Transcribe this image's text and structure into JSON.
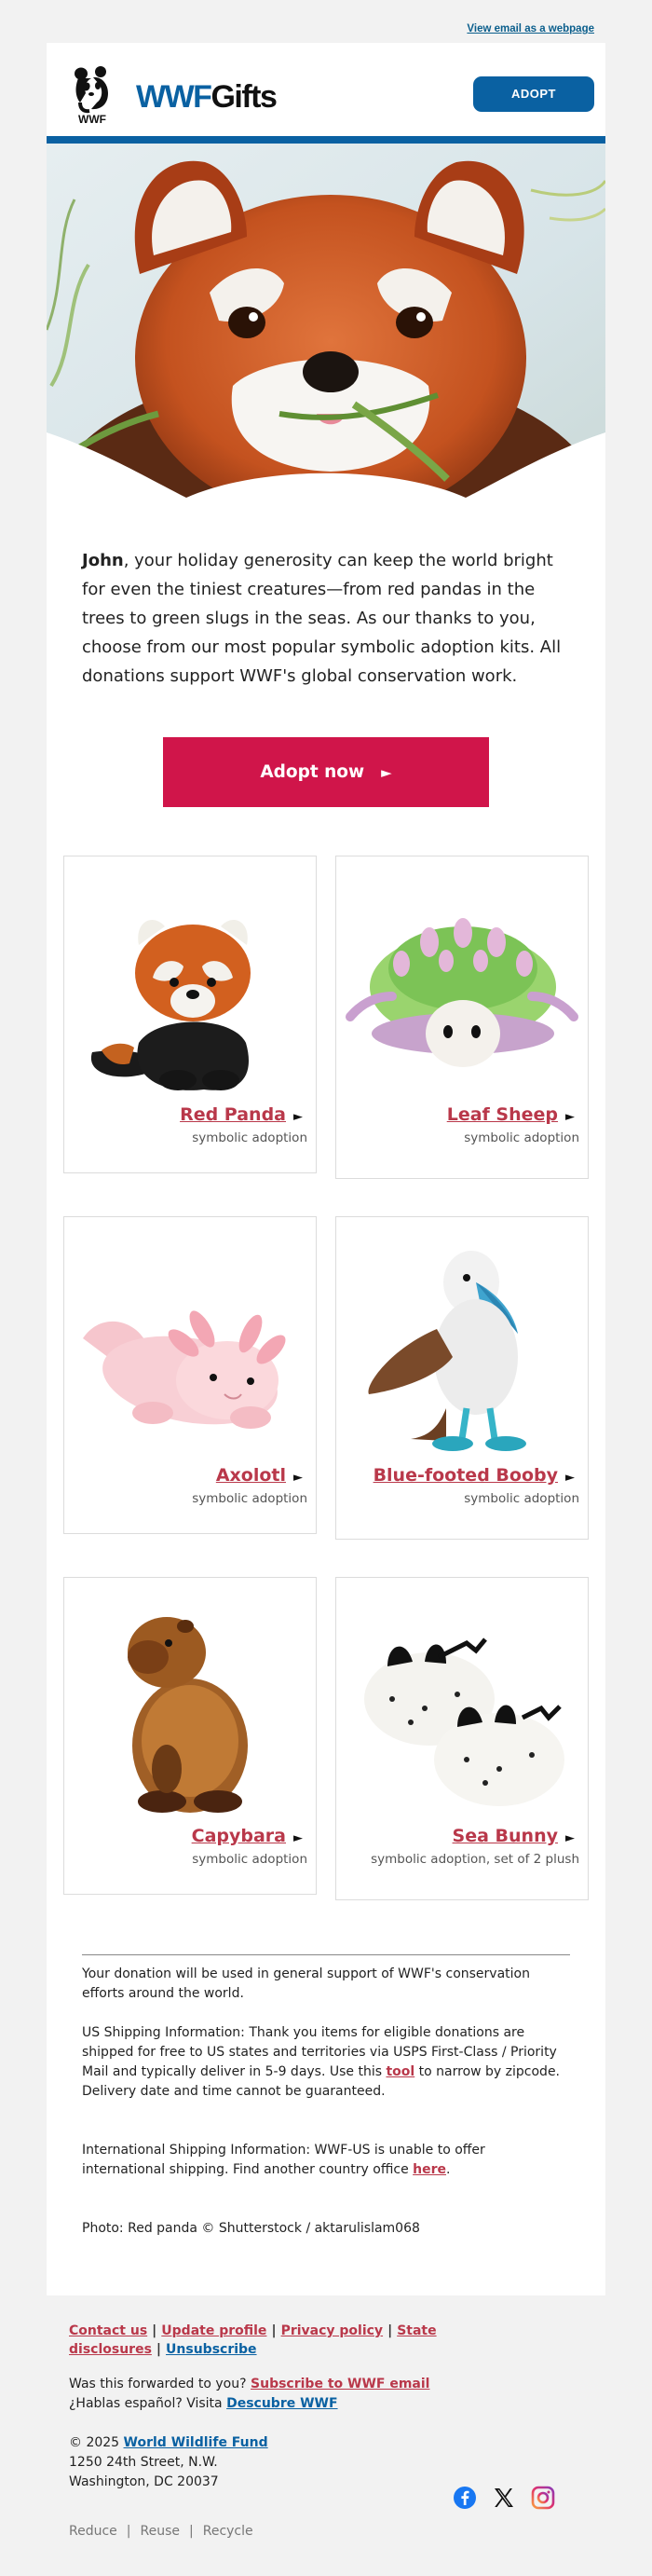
{
  "topbar": {
    "view_link": "View email as a webpage"
  },
  "header": {
    "logo_text": "WWF",
    "wordmark_brand": "WWF",
    "wordmark_suffix": "Gifts",
    "adopt_label": "ADOPT"
  },
  "intro": {
    "name": "John",
    "text": ", your holiday generosity can keep the world bright for even the tiniest creatures—from red pandas in the trees to green slugs in the seas. As our thanks to you, choose from our most popular symbolic adoption kits. All donations support WWF's global conservation work."
  },
  "cta": {
    "label": "Adopt now",
    "arrow": "►"
  },
  "products": [
    {
      "name": "Red Panda",
      "sub": "symbolic adoption",
      "icon": "red-panda-plush"
    },
    {
      "name": "Leaf Sheep",
      "sub": "symbolic adoption",
      "icon": "leaf-sheep-plush"
    },
    {
      "name": "Axolotl",
      "sub": "symbolic adoption",
      "icon": "axolotl-plush"
    },
    {
      "name": "Blue-footed Booby",
      "sub": "symbolic adoption",
      "icon": "booby-plush"
    },
    {
      "name": "Capybara",
      "sub": "symbolic adoption",
      "icon": "capybara-plush"
    },
    {
      "name": "Sea Bunny",
      "sub": "symbolic adoption, set of 2 plush",
      "icon": "sea-bunny-plush"
    }
  ],
  "arrow_glyph": "►",
  "fine_print": {
    "donation": "Your donation will be used in general support of WWF's conservation efforts around the world.",
    "us_shipping_before": "US Shipping Information: Thank you items for eligible donations are shipped for free to US states and territories via USPS First-Class / Priority Mail and typically deliver in 5-9 days. Use this ",
    "us_shipping_link": "tool",
    "us_shipping_after": " to narrow by zipcode. Delivery date and time cannot be guaranteed.",
    "intl_before": "International Shipping Information: WWF-US is unable to offer international shipping. Find another country office ",
    "intl_link": "here",
    "intl_after": ".",
    "photo_credit": "Photo: Red panda © Shutterstock / aktarulislam068"
  },
  "footer": {
    "links": [
      "Contact us",
      "Update profile",
      "Privacy policy",
      "State disclosures"
    ],
    "unsubscribe": "Unsubscribe",
    "forwarded_text": "Was this forwarded to you? ",
    "forwarded_link": "Subscribe to WWF email",
    "spanish_text": "¿Hablas español? Visita ",
    "spanish_link": "Descubre WWF",
    "copyright": "© 2025 ",
    "org_link": "World Wildlife Fund",
    "address1": "1250 24th Street, N.W.",
    "address2": "Washington, DC 20037",
    "reduce": [
      "Reduce",
      "Reuse",
      "Recycle"
    ],
    "socials": [
      "facebook-icon",
      "x-icon",
      "instagram-icon"
    ]
  },
  "colors": {
    "brand_blue": "#0a61a2",
    "cta_red": "#d0154a",
    "link_red": "#b9384a"
  }
}
